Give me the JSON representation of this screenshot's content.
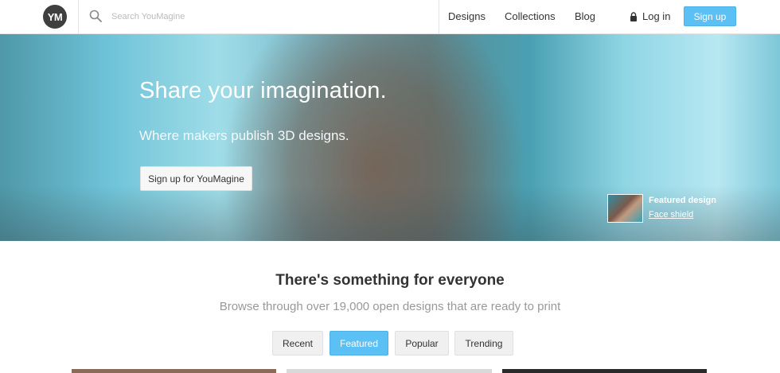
{
  "header": {
    "logo_text": "YM",
    "search_placeholder": "Search YouMagine",
    "nav": {
      "designs": "Designs",
      "collections": "Collections",
      "blog": "Blog"
    },
    "login_label": "Log in",
    "signup_label": "Sign up",
    "accent_color": "#5bc0f4"
  },
  "hero": {
    "title": "Share your imagination.",
    "subtitle": "Where makers publish 3D designs.",
    "cta_label": "Sign up for YouMagine",
    "featured_label": "Featured design",
    "featured_link": "Face shield"
  },
  "content": {
    "title": "There's something for everyone",
    "subtitle": "Browse through over 19,000 open designs that are ready to print",
    "tabs": [
      "Recent",
      "Featured",
      "Popular",
      "Trending"
    ],
    "active_tab": "Featured"
  }
}
